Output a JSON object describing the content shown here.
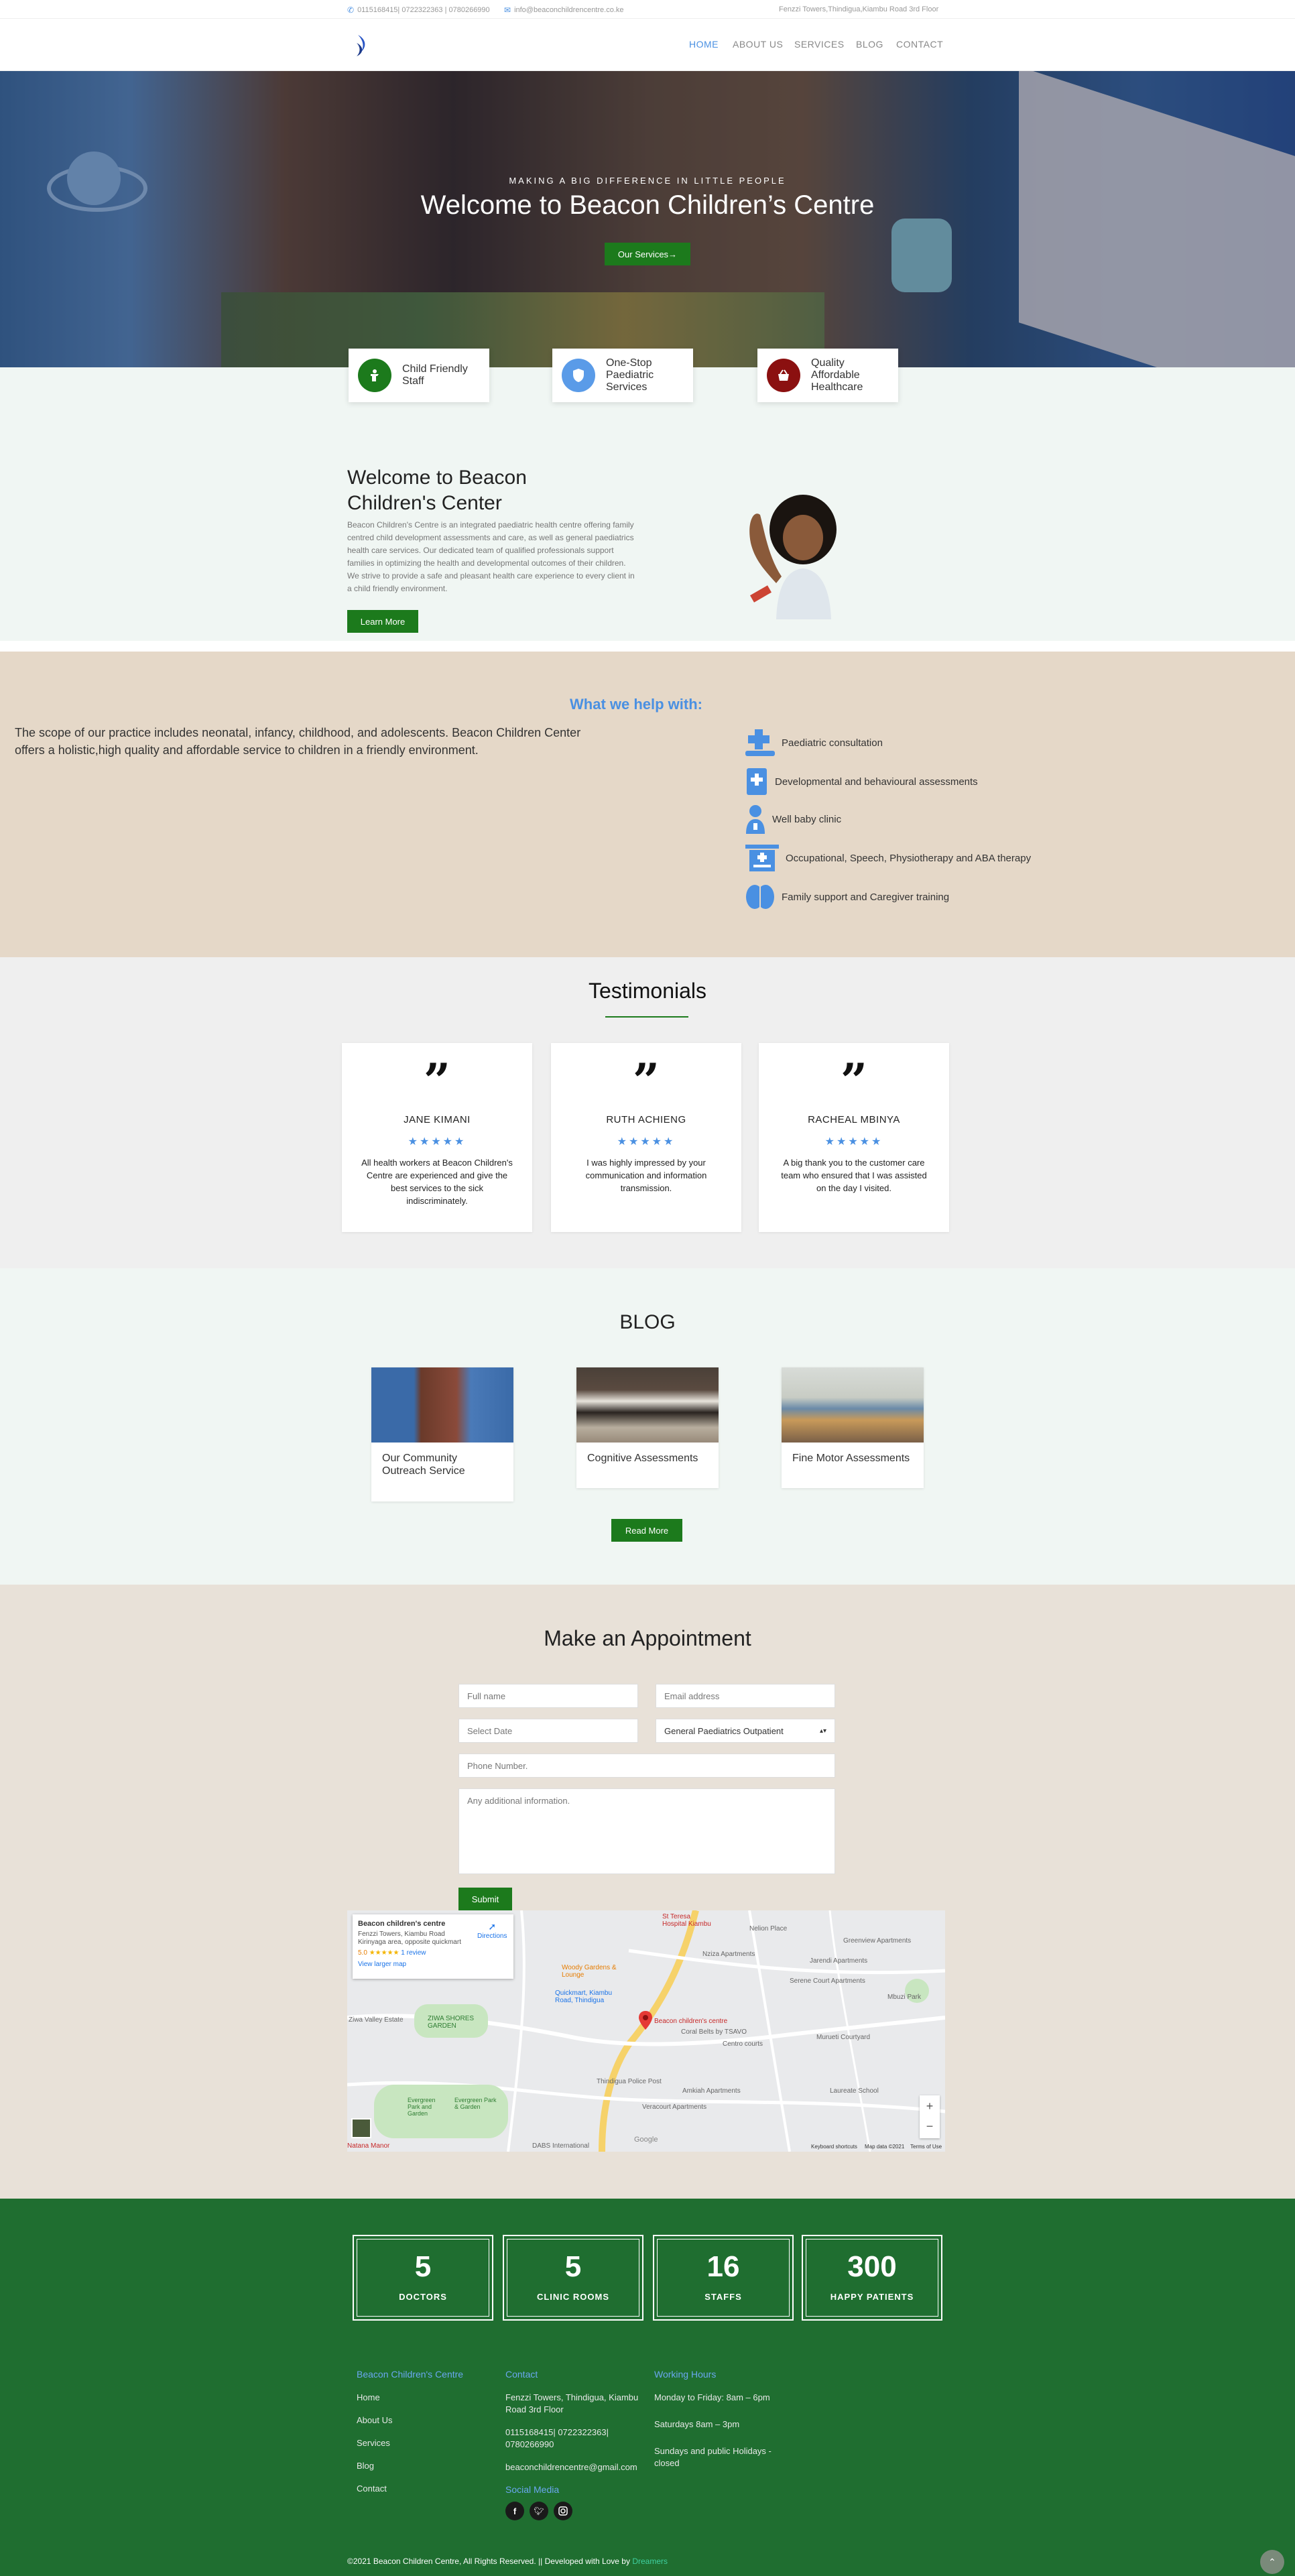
{
  "topbar": {
    "phone": "0115168415| 0722322363 | 0780266990",
    "email": "info@beaconchildrencentre.co.ke",
    "address": "Fenzzi Towers,Thindigua,Kiambu Road 3rd Floor"
  },
  "nav": {
    "items": [
      "HOME",
      "ABOUT US",
      "SERVICES",
      "BLOG",
      "CONTACT"
    ]
  },
  "hero": {
    "eyebrow": "MAKING A BIG DIFFERENCE IN LITTLE PEOPLE",
    "title": "Welcome to Beacon Children’s Centre",
    "cta": "Our Services→"
  },
  "features": [
    {
      "label": "Child Friendly Staff",
      "icon": "child-icon",
      "color": "#1c7a1c"
    },
    {
      "label": "One-Stop Paediatric Services",
      "icon": "shield-icon",
      "color": "#5a9be8"
    },
    {
      "label": "Quality Affordable Healthcare",
      "icon": "basket-icon",
      "color": "#8b1010"
    }
  ],
  "welcome": {
    "title": "Welcome to Beacon Children's Center",
    "body": "Beacon Children's Centre is an integrated paediatric health centre offering family centred child development assessments and care, as well as general paediatrics health care services. Our dedicated team of qualified professionals support families in optimizing the health and developmental outcomes of their children. We strive to provide a safe and pleasant health care experience to every client in a child friendly environment.",
    "cta": "Learn More"
  },
  "help": {
    "heading": "What we help with:",
    "intro": "The scope of our practice includes neonatal, infancy, childhood, and adolescents. Beacon Children Center offers a holistic,high quality and affordable service to children in a friendly environment.",
    "services": [
      {
        "label": "Paediatric consultation",
        "icon": "medical-cross-icon"
      },
      {
        "label": "Developmental and behavioural assessments",
        "icon": "clipboard-plus-icon"
      },
      {
        "label": "Well baby clinic",
        "icon": "doctor-icon"
      },
      {
        "label": "Occupational, Speech, Physiotherapy and ABA therapy",
        "icon": "clinic-building-icon"
      },
      {
        "label": "Family support and Caregiver training",
        "icon": "brain-icon"
      }
    ]
  },
  "testimonials": {
    "title": "Testimonials",
    "items": [
      {
        "name": "JANE KIMANI",
        "stars": "★★★★★",
        "text": "All health workers at Beacon Children's Centre are experienced and give the best services to the sick indiscriminately."
      },
      {
        "name": "RUTH ACHIENG",
        "stars": "★★★★★",
        "text": "I was highly impressed by your communication and information transmission."
      },
      {
        "name": "RACHEAL MBINYA",
        "stars": "★★★★★",
        "text": "A big thank you to the customer care team who ensured that I was assisted on the day I visited."
      }
    ]
  },
  "blog": {
    "title": "BLOG",
    "posts": [
      "Our Community Outreach Service",
      "Cognitive Assessments",
      "Fine Motor Assessments"
    ],
    "cta": "Read More"
  },
  "appointment": {
    "title": "Make an Appointment",
    "full_name": "Full name",
    "email": "Email address",
    "date": "Select Date",
    "department": "General Paediatrics Outpatient",
    "phone": "Phone Number.",
    "info": "Any additional information.",
    "submit": "Submit"
  },
  "map": {
    "place": "Beacon children's centre",
    "address": "Fenzzi Towers, Kiambu Road Kirinyaga area, opposite quickmart",
    "rating": "5.0",
    "stars": "★★★★★",
    "reviews": "1 review",
    "directions": "Directions",
    "larger": "View larger map",
    "pin_label": "Beacon children's centre",
    "labels": [
      "St Teresa Hospital Kiambu",
      "Nelion Place",
      "Greenview Apartments",
      "Nziza Apartments",
      "Jarendi Apartments",
      "Woody Gardens & Lounge",
      "Serene Court Apartments",
      "Mbuzi Park",
      "Quickmart, Kiambu Road, Thindigua",
      "Coral Belts by TSAVO",
      "Centro courts",
      "Murueti Courtyard",
      "Ziwa Valley Estate",
      "ZIWA SHORES GARDEN",
      "Thindigua Police Post",
      "Amkiah Apartments",
      "Laureate School",
      "Veracourt Apartments",
      "Evergreen Park and Garden",
      "Evergreen Park & Garden",
      "DABS International",
      "Natana Manor",
      "Google",
      "Keyboard shortcuts",
      "Map data ©2021",
      "Terms of Use"
    ]
  },
  "stats": [
    {
      "value": "5",
      "label": "DOCTORS"
    },
    {
      "value": "5",
      "label": "CLINIC ROOMS"
    },
    {
      "value": "16",
      "label": "STAFFS"
    },
    {
      "value": "300",
      "label": "HAPPY PATIENTS"
    }
  ],
  "footer": {
    "col1_title": "Beacon Children's Centre",
    "links": [
      "Home",
      "About Us",
      "Services",
      "Blog",
      "Contact"
    ],
    "col2_title": "Contact",
    "address": "Fenzzi Towers, Thindigua, Kiambu Road 3rd Floor",
    "phones": "0115168415| 0722322363| 0780266990",
    "email": "beaconchildrencentre@gmail.com",
    "social_title": "Social Media",
    "col3_title": "Working Hours",
    "hours": [
      "Monday to Friday: 8am – 6pm",
      "Saturdays 8am – 3pm",
      "Sundays and public Holidays - closed"
    ],
    "copyright": "©2021 Beacon Children Centre, All Rights Reserved. || Developed with Love by",
    "developer": "Dreamers"
  },
  "colors": {
    "green": "#1c7a1c",
    "footer": "#1f6e30",
    "blue": "#4a90e2"
  }
}
